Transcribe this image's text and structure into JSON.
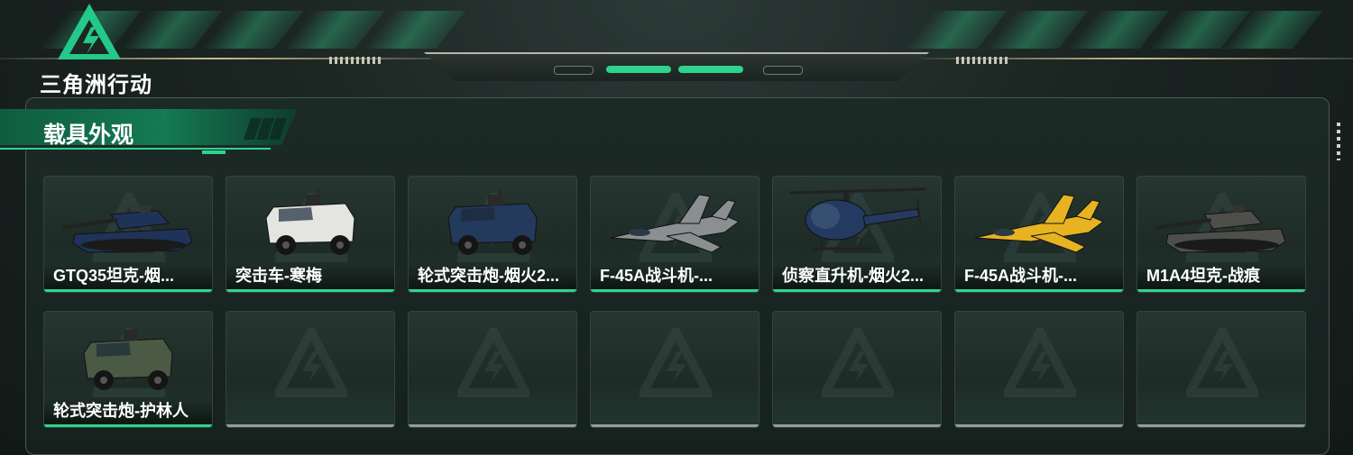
{
  "app": {
    "logo_text": "三角洲行动",
    "accent": "#2fd38e"
  },
  "section": {
    "title": "载具外观"
  },
  "items": [
    {
      "name": "GTQ35坦克-烟...",
      "kind": "tank",
      "color": "#1f3359",
      "filled": true
    },
    {
      "name": "突击车-寒梅",
      "kind": "armored-car",
      "color": "#e4e4e0",
      "filled": true
    },
    {
      "name": "轮式突击炮-烟火2...",
      "kind": "armored-car",
      "color": "#233a5c",
      "filled": true
    },
    {
      "name": "F-45A战斗机-...",
      "kind": "jet",
      "color": "#8a9092",
      "filled": true
    },
    {
      "name": "侦察直升机-烟火2...",
      "kind": "helicopter",
      "color": "#243a60",
      "filled": true
    },
    {
      "name": "F-45A战斗机-...",
      "kind": "jet",
      "color": "#e8b321",
      "filled": true
    },
    {
      "name": "M1A4坦克-战痕",
      "kind": "tank",
      "color": "#4e4f4a",
      "filled": true
    },
    {
      "name": "轮式突击炮-护林人",
      "kind": "armored-car",
      "color": "#4a5a44",
      "filled": true
    },
    {
      "name": "",
      "filled": false
    },
    {
      "name": "",
      "filled": false
    },
    {
      "name": "",
      "filled": false
    },
    {
      "name": "",
      "filled": false
    },
    {
      "name": "",
      "filled": false
    },
    {
      "name": "",
      "filled": false
    }
  ]
}
